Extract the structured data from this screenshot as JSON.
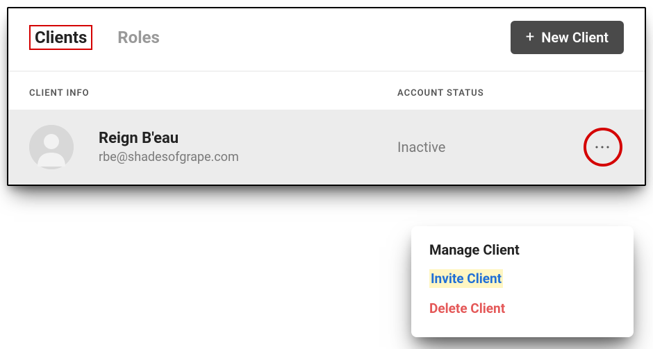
{
  "header": {
    "tabs": [
      {
        "label": "Clients",
        "active": true
      },
      {
        "label": "Roles",
        "active": false
      }
    ],
    "new_client_label": "New Client"
  },
  "columns": {
    "client_info": "CLIENT INFO",
    "account_status": "ACCOUNT STATUS"
  },
  "rows": [
    {
      "name": "Reign B'eau",
      "email": "rbe@shadesofgrape.com",
      "status": "Inactive"
    }
  ],
  "dropdown": {
    "heading": "Manage Client",
    "invite": "Invite Client",
    "delete": "Delete Client"
  },
  "highlights": {
    "tab_outline_color": "#d40000",
    "action_circle_color": "#d40000",
    "invite_highlight_bg": "#fff6c2"
  }
}
